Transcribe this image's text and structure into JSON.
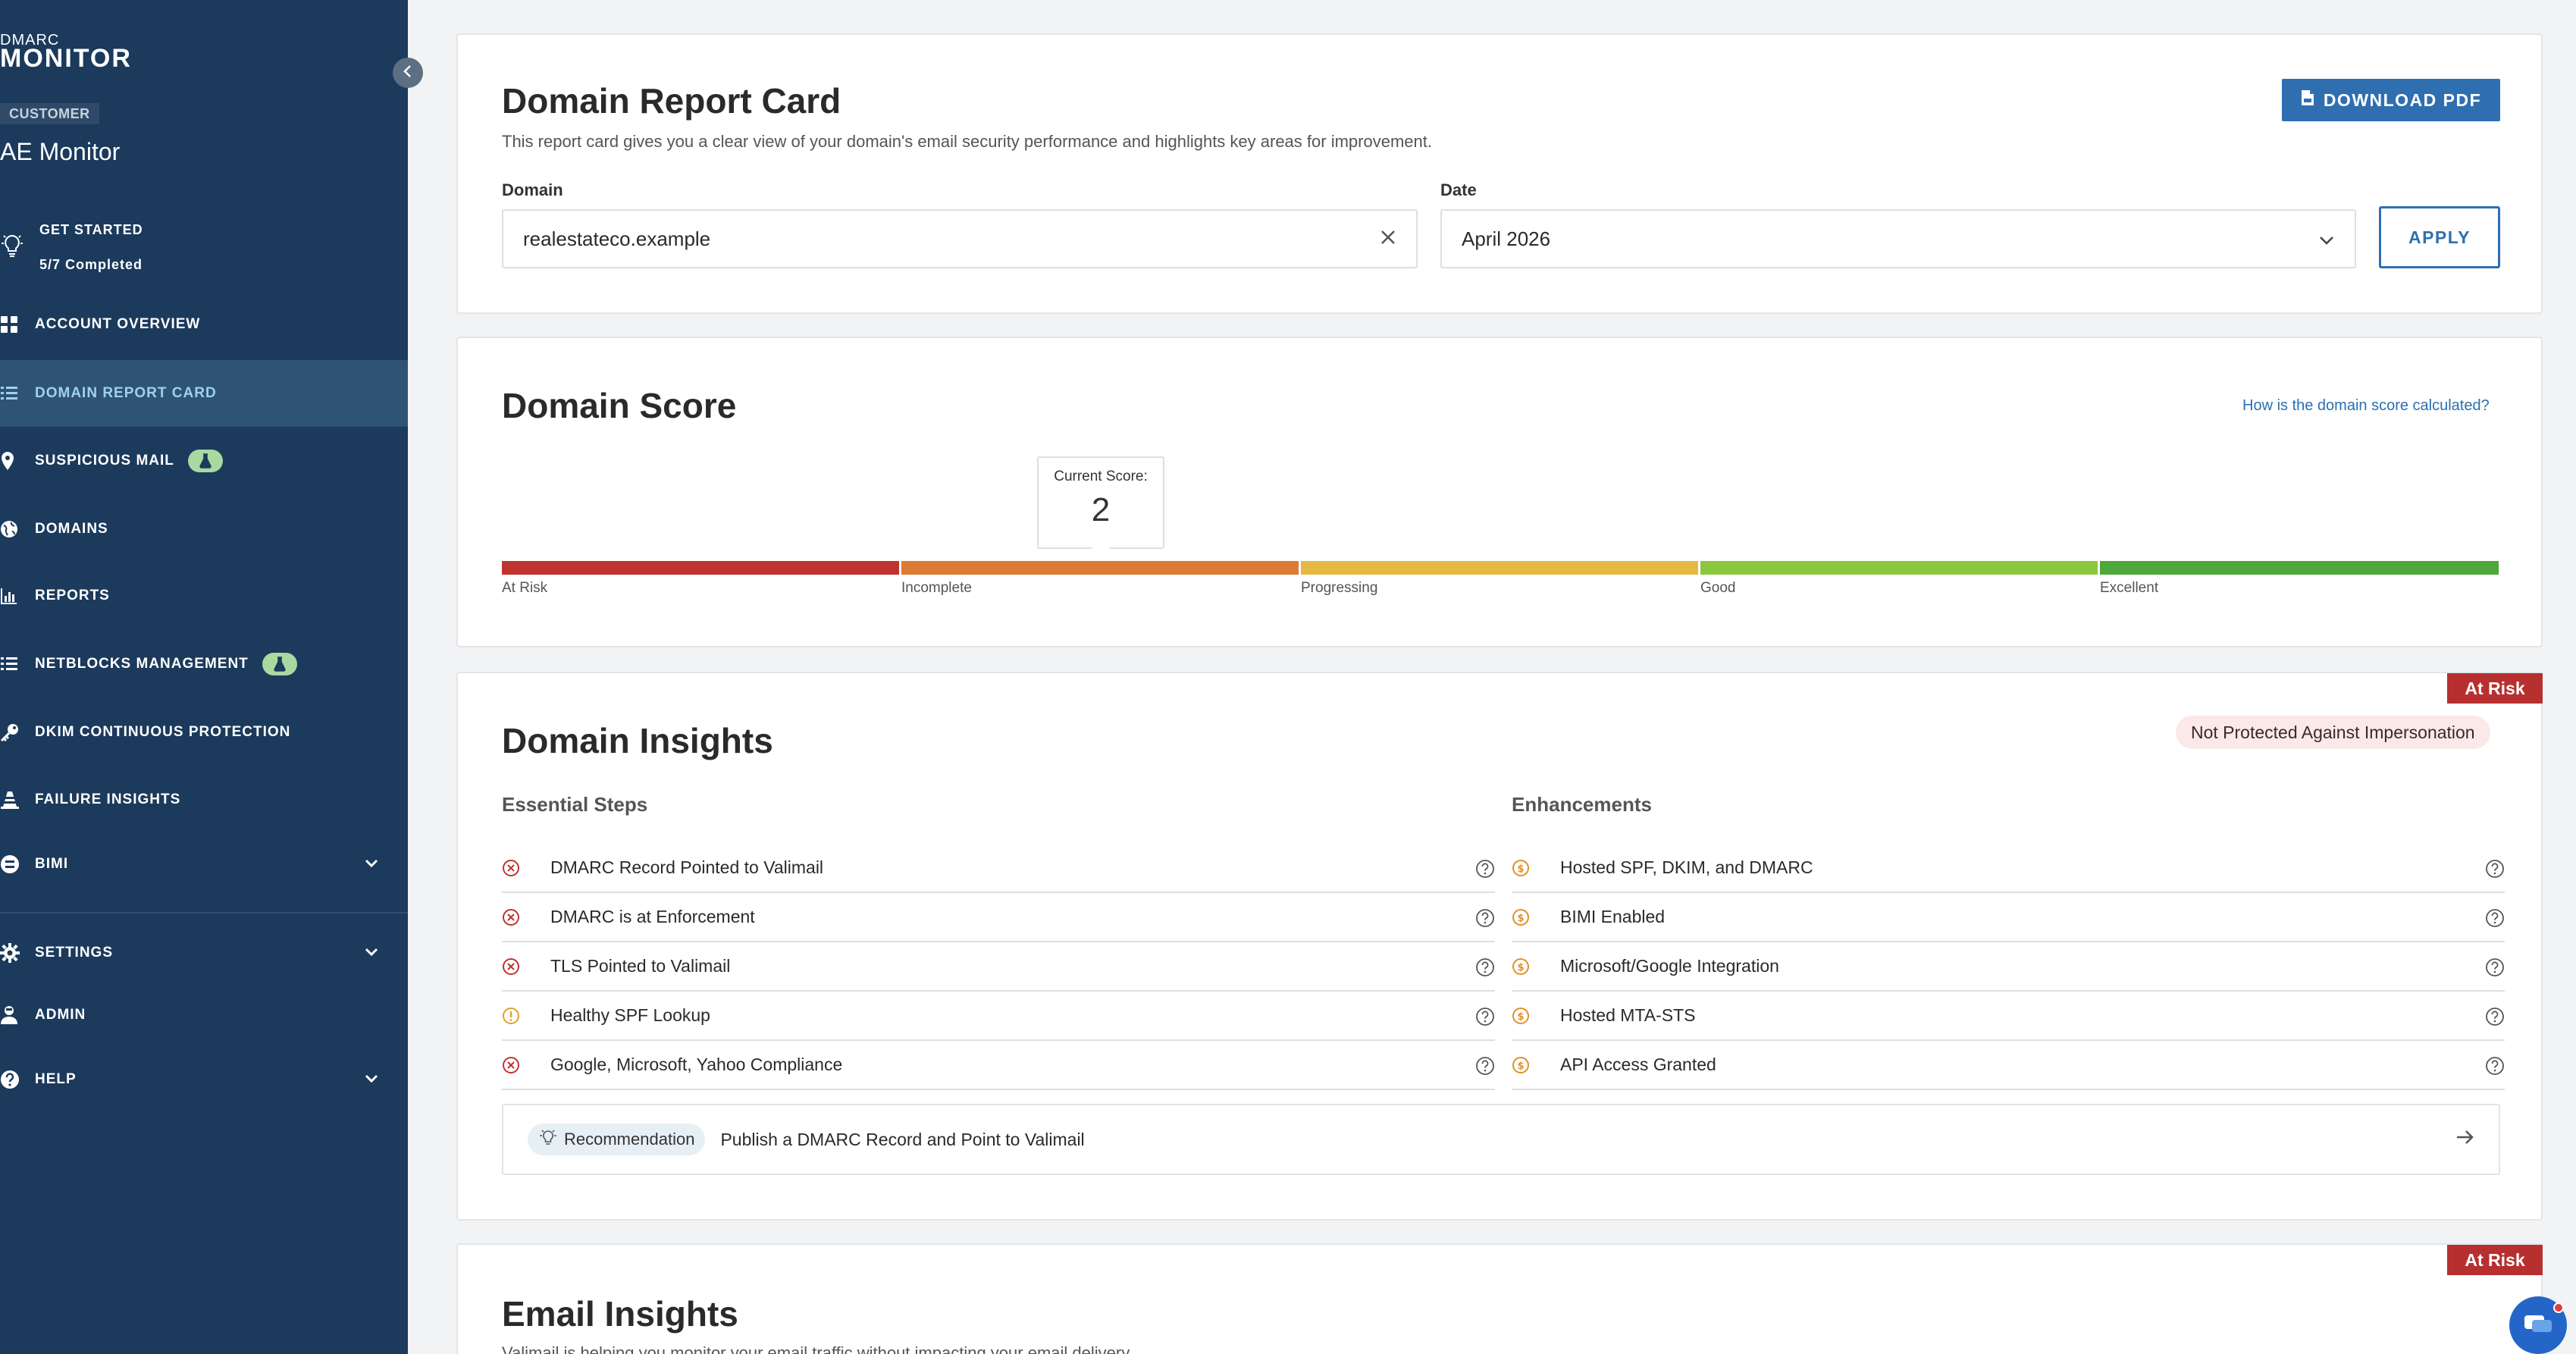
{
  "sidebar": {
    "logo_small": "DMARC",
    "logo_big": "MONITOR",
    "role": "CUSTOMER",
    "account_name": "AE Monitor",
    "get_started": {
      "label": "GET STARTED",
      "progress": "5/7 Completed"
    },
    "items": [
      {
        "label": "ACCOUNT OVERVIEW",
        "icon": "grid-icon"
      },
      {
        "label": "DOMAIN REPORT CARD",
        "icon": "list-icon",
        "active": true
      },
      {
        "label": "SUSPICIOUS MAIL",
        "icon": "location-pin-icon",
        "beta": true
      },
      {
        "label": "DOMAINS",
        "icon": "globe-icon"
      },
      {
        "label": "REPORTS",
        "icon": "bar-chart-icon"
      },
      {
        "label": "NETBLOCKS MANAGEMENT",
        "icon": "list-icon",
        "beta": true
      },
      {
        "label": "DKIM CONTINUOUS PROTECTION",
        "icon": "key-icon"
      },
      {
        "label": "FAILURE INSIGHTS",
        "icon": "traffic-cone-icon"
      },
      {
        "label": "BIMI",
        "icon": "badge-icon",
        "expandable": true
      },
      {
        "label": "SETTINGS",
        "icon": "gear-icon",
        "expandable": true
      },
      {
        "label": "ADMIN",
        "icon": "admin-user-icon"
      },
      {
        "label": "HELP",
        "icon": "question-icon",
        "expandable": true
      }
    ]
  },
  "report": {
    "title": "Domain Report Card",
    "subtitle": "This report card gives you a clear view of your domain's email security performance and highlights key areas for improvement.",
    "download_label": "DOWNLOAD PDF",
    "domain_label": "Domain",
    "domain_value": "realestateco.example",
    "date_label": "Date",
    "date_value": "April 2026",
    "apply_label": "APPLY"
  },
  "score": {
    "title": "Domain Score",
    "help_link": "How is the domain score calculated?",
    "current_label": "Current Score:",
    "current_value": "2",
    "levels": [
      {
        "label": "At Risk",
        "color": "#c0332f"
      },
      {
        "label": "Incomplete",
        "color": "#dd7b35"
      },
      {
        "label": "Progressing",
        "color": "#e6b844"
      },
      {
        "label": "Good",
        "color": "#8cc63f"
      },
      {
        "label": "Excellent",
        "color": "#4ea83a"
      }
    ]
  },
  "insights": {
    "tag": "At Risk",
    "title": "Domain Insights",
    "status_pill": "Not Protected Against Impersonation",
    "essential_heading": "Essential Steps",
    "enhancements_heading": "Enhancements",
    "essential": [
      {
        "label": "DMARC Record Pointed to Valimail",
        "status": "fail"
      },
      {
        "label": "DMARC is at Enforcement",
        "status": "fail"
      },
      {
        "label": "TLS Pointed to Valimail",
        "status": "fail"
      },
      {
        "label": "Healthy SPF Lookup",
        "status": "warning"
      },
      {
        "label": "Google, Microsoft, Yahoo Compliance",
        "status": "fail"
      }
    ],
    "enhancements": [
      {
        "label": "Hosted SPF, DKIM, and DMARC"
      },
      {
        "label": "BIMI Enabled"
      },
      {
        "label": "Microsoft/Google Integration"
      },
      {
        "label": "Hosted MTA-STS"
      },
      {
        "label": "API Access Granted"
      }
    ],
    "recommendation_label": "Recommendation",
    "recommendation_text": "Publish a DMARC Record and Point to Valimail"
  },
  "email_insights": {
    "tag": "At Risk",
    "title": "Email Insights",
    "subtitle": "Valimail is helping you monitor your email traffic without impacting your email delivery."
  }
}
